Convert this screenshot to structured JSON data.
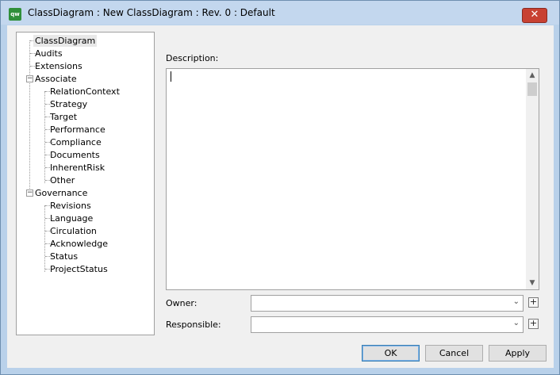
{
  "window": {
    "title": "ClassDiagram : New ClassDiagram : Rev. 0  : Default",
    "app_icon_text": "qw"
  },
  "tree": {
    "items": [
      {
        "label": "ClassDiagram",
        "level": 0,
        "selected": true
      },
      {
        "label": "Audits",
        "level": 0
      },
      {
        "label": "Extensions",
        "level": 0
      },
      {
        "label": "Associate",
        "level": 0,
        "expandable": true
      },
      {
        "label": "RelationContext",
        "level": 1
      },
      {
        "label": "Strategy",
        "level": 1
      },
      {
        "label": "Target",
        "level": 1
      },
      {
        "label": "Performance",
        "level": 1
      },
      {
        "label": "Compliance",
        "level": 1
      },
      {
        "label": "Documents",
        "level": 1
      },
      {
        "label": "InherentRisk",
        "level": 1
      },
      {
        "label": "Other",
        "level": 1
      },
      {
        "label": "Governance",
        "level": 0,
        "expandable": true
      },
      {
        "label": "Revisions",
        "level": 1
      },
      {
        "label": "Language",
        "level": 1
      },
      {
        "label": "Circulation",
        "level": 1
      },
      {
        "label": "Acknowledge",
        "level": 1
      },
      {
        "label": "Status",
        "level": 1
      },
      {
        "label": "ProjectStatus",
        "level": 1
      }
    ]
  },
  "form": {
    "description_label": "Description:",
    "description_value": "",
    "owner_label": "Owner:",
    "owner_value": "",
    "responsible_label": "Responsible:",
    "responsible_value": ""
  },
  "buttons": {
    "ok": "OK",
    "cancel": "Cancel",
    "apply": "Apply",
    "plus": "+",
    "close": "✕"
  },
  "colors": {
    "titlebar": "#c3d7ee",
    "close_button": "#c84132",
    "default_button_border": "#3c7fb1"
  }
}
